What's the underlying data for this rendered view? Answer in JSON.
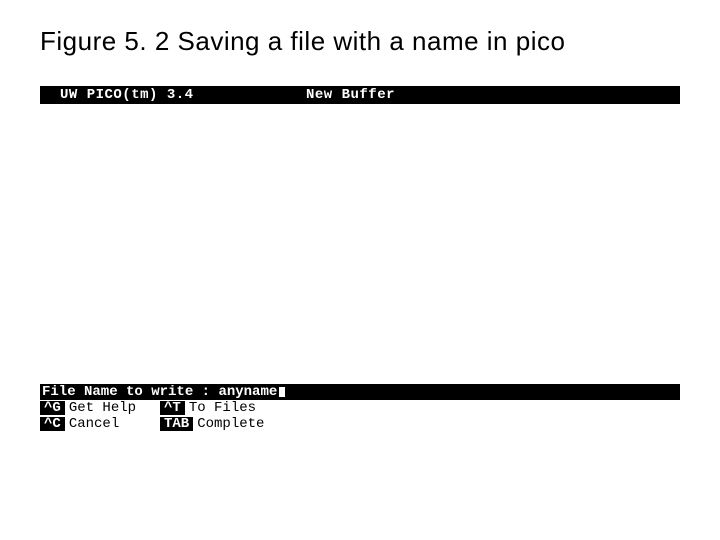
{
  "figure": {
    "caption": "Figure 5. 2  Saving a file with a name in pico"
  },
  "titlebar": {
    "app_name": "UW PICO(tm) 3.4",
    "buffer_name": "New Buffer"
  },
  "prompt": {
    "label": "File Name to write : ",
    "value": "anyname"
  },
  "shortcuts": {
    "row1": [
      {
        "key": "^G",
        "label": "Get Help"
      },
      {
        "key": "^T",
        "label": "To Files"
      }
    ],
    "row2": [
      {
        "key": "^C",
        "label": "Cancel"
      },
      {
        "key": "TAB",
        "label": "Complete"
      }
    ]
  }
}
